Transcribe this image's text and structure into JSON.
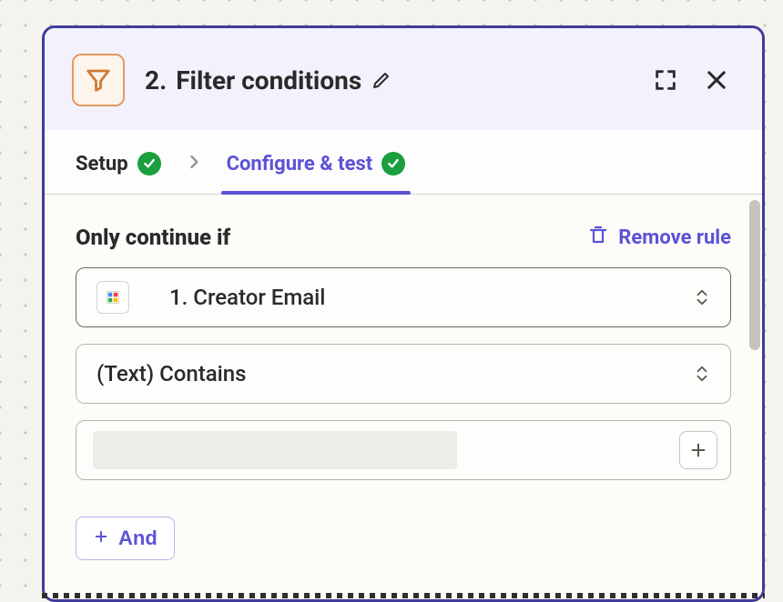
{
  "header": {
    "step_number": "2.",
    "title": "Filter conditions"
  },
  "tabs": {
    "setup_label": "Setup",
    "configure_label": "Configure & test"
  },
  "rule": {
    "section_title": "Only continue if",
    "remove_label": "Remove rule",
    "field_select": "1. Creator Email",
    "operator_select": "(Text) Contains",
    "value": "",
    "and_button": "And"
  },
  "colors": {
    "accent": "#5b53d6",
    "border": "#3f3c9a",
    "success": "#1b9e3e",
    "filter_icon": "#d07a34"
  }
}
